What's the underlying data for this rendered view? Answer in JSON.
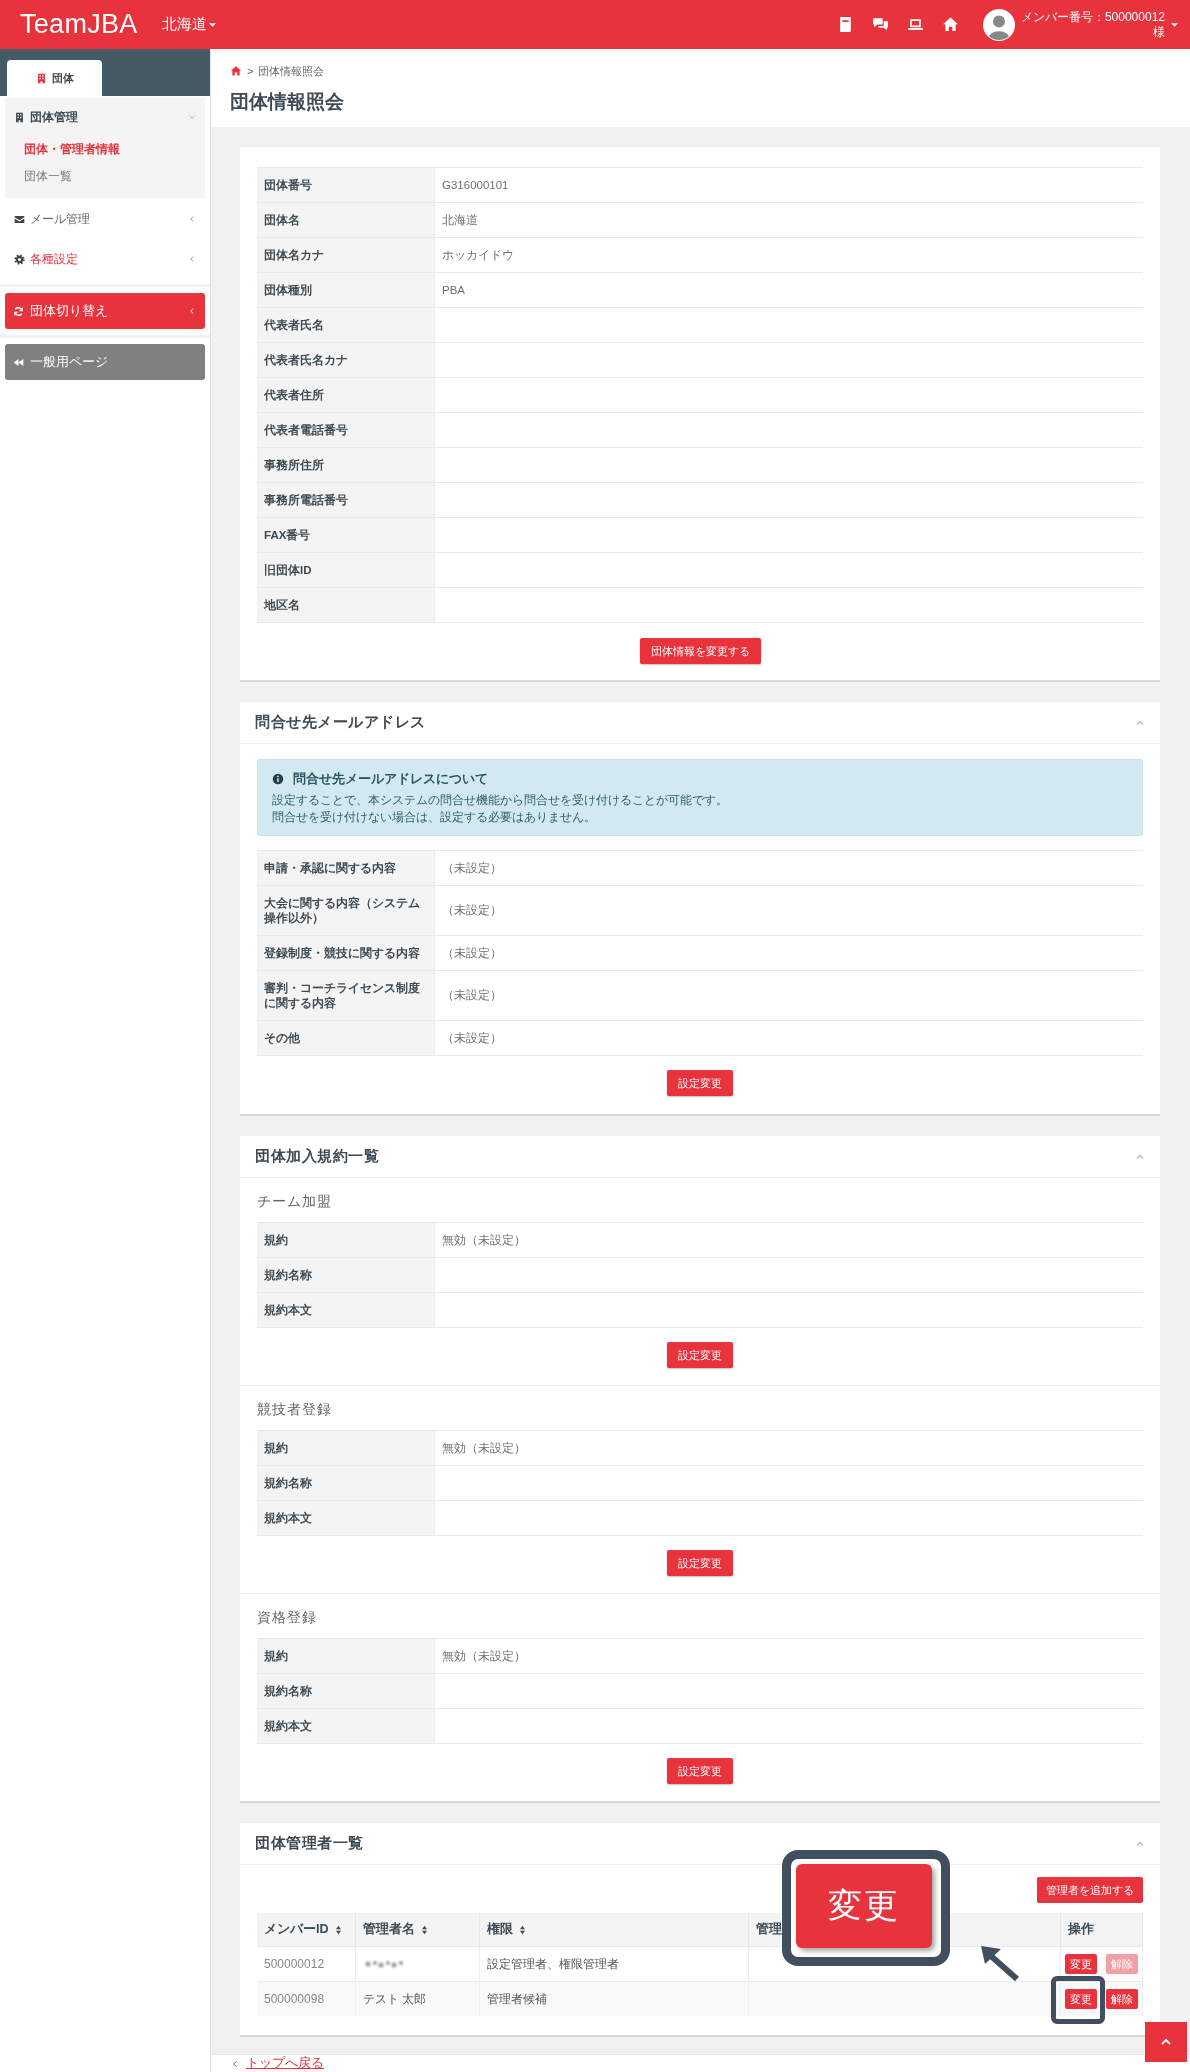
{
  "header": {
    "logo": "TeamJBA",
    "region": "北海道",
    "member_label": "メンバー番号：500000012",
    "honorific": "様"
  },
  "sidebar": {
    "tab": {
      "label": "団体",
      "selected": true
    },
    "menu": [
      {
        "label": "団体管理",
        "selected": false,
        "expanded": true,
        "children": [
          {
            "label": "団体・管理者情報",
            "selected": true
          },
          {
            "label": "団体一覧",
            "selected": false
          }
        ]
      },
      {
        "label": "メール管理",
        "selected": false,
        "expanded": false
      },
      {
        "label": "各種設定",
        "selected": true,
        "expanded": false
      }
    ],
    "buttons": [
      {
        "label": "団体切り替え",
        "kind": "switch"
      },
      {
        "label": "一般用ページ",
        "kind": "general"
      }
    ]
  },
  "breadcrumb": {
    "separator": ">",
    "current": "団体情報照会"
  },
  "page_title": "団体情報照会",
  "group_info": {
    "rows": [
      {
        "label": "団体番号",
        "value": "G316000101"
      },
      {
        "label": "団体名",
        "value": "北海道"
      },
      {
        "label": "団体名カナ",
        "value": "ホッカイドウ"
      },
      {
        "label": "団体種別",
        "value": "PBA"
      },
      {
        "label": "代表者氏名"
      },
      {
        "label": "代表者氏名カナ"
      },
      {
        "label": "代表者住所"
      },
      {
        "label": "代表者電話番号"
      },
      {
        "label": "事務所住所"
      },
      {
        "label": "事務所電話番号"
      },
      {
        "label": "FAX番号"
      },
      {
        "label": "旧団体ID"
      },
      {
        "label": "地区名"
      }
    ],
    "button": "団体情報を変更する"
  },
  "contact": {
    "title": "問合せ先メールアドレス",
    "expanded": true,
    "alert": {
      "title": "問合せ先メールアドレスについて",
      "lines": [
        "設定することで、本システムの問合せ機能から問合せを受け付けることが可能です。",
        "問合せを受け付けない場合は、設定する必要はありません。"
      ]
    },
    "rows": [
      {
        "label": "申請・承認に関する内容",
        "value": "（未設定）"
      },
      {
        "label": "大会に関する内容（システム操作以外）",
        "value": "（未設定）"
      },
      {
        "label": "登録制度・競技に関する内容",
        "value": "（未設定）"
      },
      {
        "label": "審判・コーチライセンス制度に関する内容",
        "value": "（未設定）"
      },
      {
        "label": "その他",
        "value": "（未設定）"
      }
    ],
    "button": "設定変更"
  },
  "terms": {
    "title": "団体加入規約一覧",
    "expanded": true,
    "sections": [
      {
        "title": "チーム加盟",
        "rows": [
          {
            "label": "規約",
            "value": "無効（未設定）"
          },
          {
            "label": "規約名称"
          },
          {
            "label": "規約本文"
          }
        ],
        "button": "設定変更"
      },
      {
        "title": "競技者登録",
        "rows": [
          {
            "label": "規約",
            "value": "無効（未設定）"
          },
          {
            "label": "規約名称"
          },
          {
            "label": "規約本文"
          }
        ],
        "button": "設定変更"
      },
      {
        "title": "資格登録",
        "rows": [
          {
            "label": "規約",
            "value": "無効（未設定）"
          },
          {
            "label": "規約名称"
          },
          {
            "label": "規約本文"
          }
        ],
        "button": "設定変更"
      }
    ]
  },
  "admins": {
    "title": "団体管理者一覧",
    "expanded": true,
    "add_button": "管理者を追加する",
    "columns": [
      {
        "label": "メンバーID",
        "sortable": true
      },
      {
        "label": "管理者名",
        "sortable": true
      },
      {
        "label": "権限",
        "sortable": true
      },
      {
        "label": "管理",
        "sortable": false
      },
      {
        "label": "操作",
        "sortable": false
      }
    ],
    "rows": [
      {
        "member_id": "500000012",
        "redacted": true,
        "role": "設定管理者、権限管理者",
        "actions": [
          {
            "label": "変更",
            "disabled": false,
            "highlighted": false
          },
          {
            "label": "解除",
            "disabled": true,
            "highlighted": false
          }
        ]
      },
      {
        "member_id": "500000098",
        "redacted": false,
        "name": "テスト 太郎",
        "role": "管理者候補",
        "actions": [
          {
            "label": "変更",
            "disabled": false,
            "highlighted": true
          },
          {
            "label": "解除",
            "disabled": false,
            "highlighted": false
          }
        ]
      }
    ],
    "callout": {
      "label": "変更"
    }
  },
  "footer": {
    "back_link": "トップへ戻る"
  }
}
